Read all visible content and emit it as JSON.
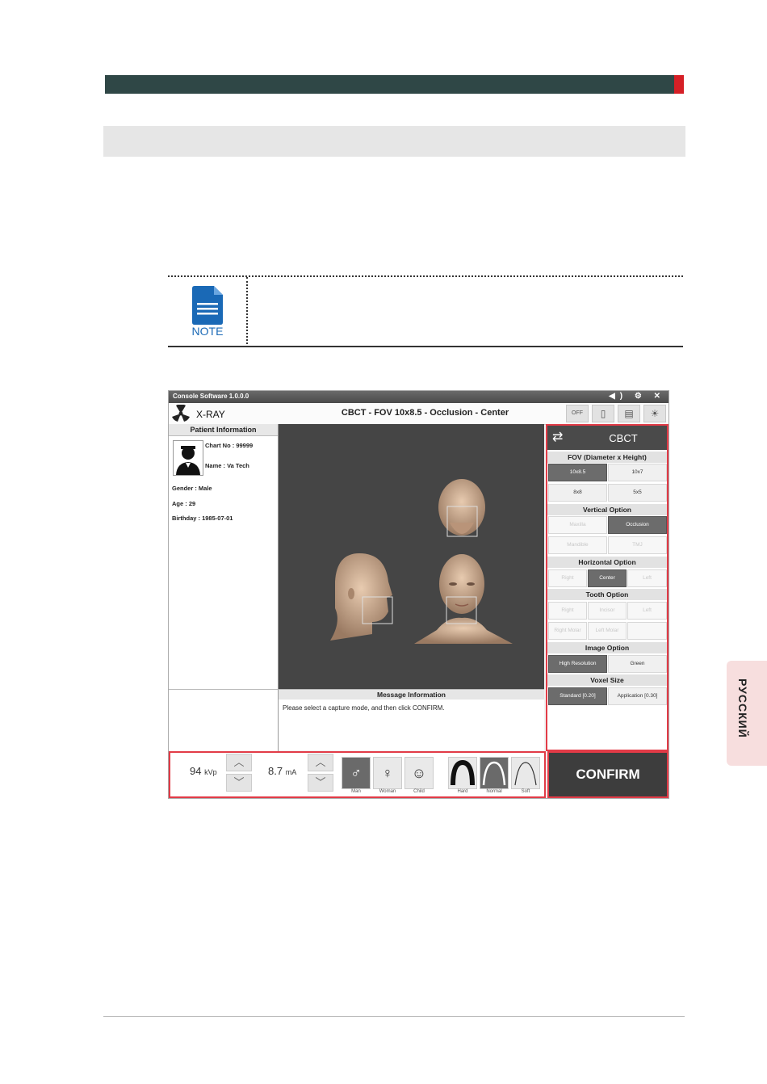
{
  "note": {
    "label": "NOTE"
  },
  "side_tab": {
    "label": "РУССКИЙ"
  },
  "app": {
    "window_title": "Console Software  1.0.0.0",
    "titlebar_icons": "◀) ⚙ ✕",
    "module_label": "X-RAY",
    "mode_title": "CBCT - FOV 10x8.5 - Occlusion - Center",
    "header_buttons": [
      "OFF",
      "▯",
      "▤",
      "☀"
    ]
  },
  "patient": {
    "header": "Patient Information",
    "chart_no": "Chart No : 99999",
    "name": "Name : Va Tech",
    "gender": "Gender : Male",
    "age": "Age : 29",
    "birthday": "Birthday : 1985-07-01"
  },
  "message": {
    "header": "Message Information",
    "text": "Please select a capture mode, and then click CONFIRM."
  },
  "right_panel": {
    "swap_icon": "⇄",
    "mode": "CBCT",
    "fov_label": "FOV (Diameter x Height)",
    "fov_options": [
      "10x8.5",
      "10x7",
      "8x8",
      "5x5"
    ],
    "vertical_label": "Vertical Option",
    "vertical_options": [
      "Maxilla",
      "Occlusion",
      "Mandible",
      "TMJ"
    ],
    "horizontal_label": "Horizontal Option",
    "horizontal_options": [
      "Right",
      "Center",
      "Left"
    ],
    "tooth_label": "Tooth Option",
    "tooth_options": [
      "Right",
      "Incisor",
      "Left",
      "Right Molar",
      "Left Molar"
    ],
    "image_label": "Image Option",
    "image_options": [
      "High Resolution",
      "Green"
    ],
    "voxel_label": "Voxel Size",
    "voxel_options": [
      "Standard  [0.20]",
      "Application [0.30]"
    ]
  },
  "exposure": {
    "kvp_value": "94",
    "kvp_unit": "kVp",
    "ma_value": "8.7",
    "ma_unit": "mA",
    "up_arrow": "︿",
    "down_arrow": "﹀",
    "patient_types": [
      {
        "icon": "man-icon",
        "glyph": "♂",
        "label": "Man",
        "selected": true
      },
      {
        "icon": "woman-icon",
        "glyph": "♀",
        "label": "Woman",
        "selected": false
      },
      {
        "icon": "child-icon",
        "glyph": "☺",
        "label": "Child",
        "selected": false
      }
    ],
    "arch_types": [
      {
        "label": "Hard",
        "selected": false
      },
      {
        "label": "Normal",
        "selected": true
      },
      {
        "label": "Soft",
        "selected": false
      }
    ]
  },
  "confirm_label": "CONFIRM",
  "colors": {
    "accent_red": "#e23b47",
    "header_teal": "#2f4746",
    "brand_red": "#d51f26",
    "note_blue": "#1a69b6"
  }
}
